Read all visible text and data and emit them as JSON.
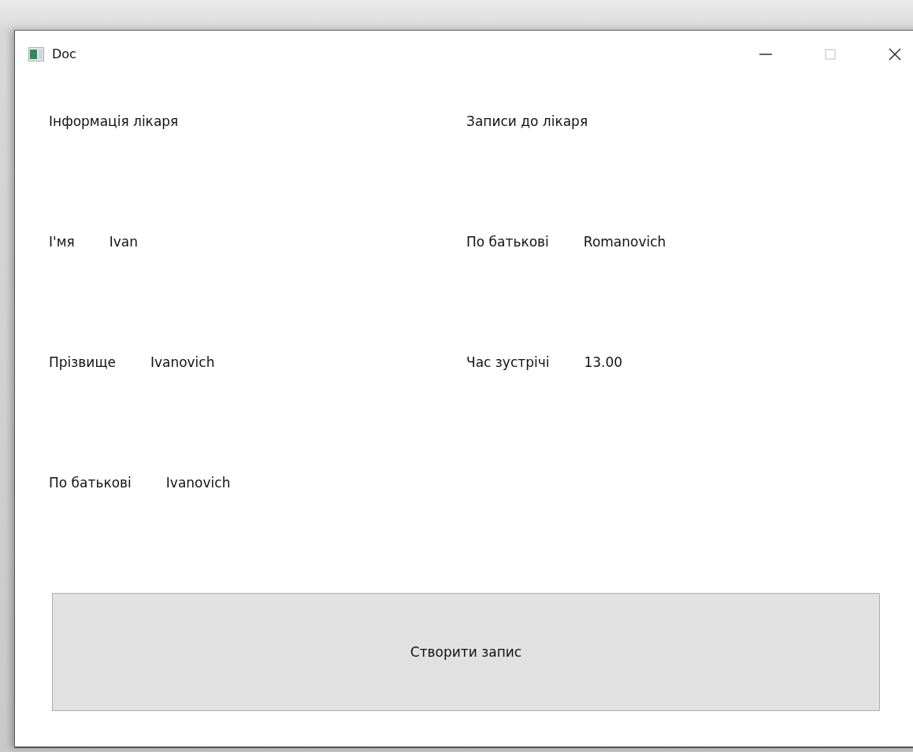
{
  "window": {
    "title": "Doc",
    "controls": [
      {
        "kind": "minimize",
        "disabled": false
      },
      {
        "kind": "maximize",
        "disabled": true
      },
      {
        "kind": "close",
        "disabled": false
      }
    ]
  },
  "left": {
    "heading": "Інформація лікаря",
    "fields": [
      {
        "label": "І'мя",
        "value": "Ivan"
      },
      {
        "label": "Прізвище",
        "value": "Ivanovich"
      },
      {
        "label": "По батькові",
        "value": "Ivanovich"
      }
    ]
  },
  "right": {
    "heading": "Записи до лікаря",
    "fields": [
      {
        "label": "По батькові",
        "value": "Romanovich"
      },
      {
        "label": "Час зустрічі",
        "value": "13.00"
      }
    ]
  },
  "button": {
    "label": "Створити запис"
  }
}
